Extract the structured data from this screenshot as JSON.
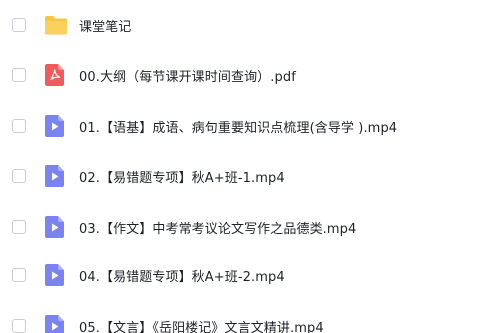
{
  "files": [
    {
      "name": "课堂笔记",
      "icon": "folder-icon",
      "color": "#F7C543"
    },
    {
      "name": "00.大纲（每节课开课时间查询）.pdf",
      "icon": "pdf-icon",
      "color": "#F25B5B"
    },
    {
      "name": "01.【语基】成语、病句重要知识点梳理(含导学 ).mp4",
      "icon": "video-icon",
      "color": "#7B82F2"
    },
    {
      "name": "02.【易错题专项】秋A+班-1.mp4",
      "icon": "video-icon",
      "color": "#7B82F2"
    },
    {
      "name": "03.【作文】中考常考议论文写作之品德类.mp4",
      "icon": "video-icon",
      "color": "#7B82F2"
    },
    {
      "name": "04.【易错题专项】秋A+班-2.mp4",
      "icon": "video-icon",
      "color": "#7B82F2"
    },
    {
      "name": "05.【文言】《岳阳楼记》文言文精讲.mp4",
      "icon": "video-icon",
      "color": "#7B82F2"
    }
  ]
}
